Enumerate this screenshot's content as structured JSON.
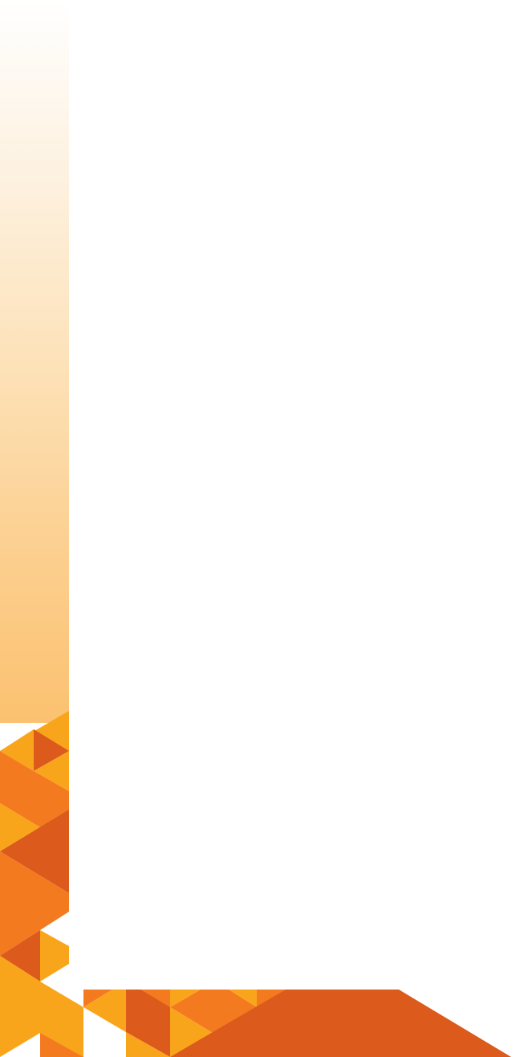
{
  "page": {
    "kind": "blank decorative slide template"
  },
  "colors": {
    "background": "#ffffff",
    "gradient_top": "#ffffff",
    "gradient_bottom": "#fbc170",
    "yellow": "#f9a51c",
    "orange": "#f47a20",
    "dark_orange": "#db5a1c"
  },
  "decorations": {
    "left_strip": "gradient-fade",
    "bottom_pattern": "triangles"
  }
}
